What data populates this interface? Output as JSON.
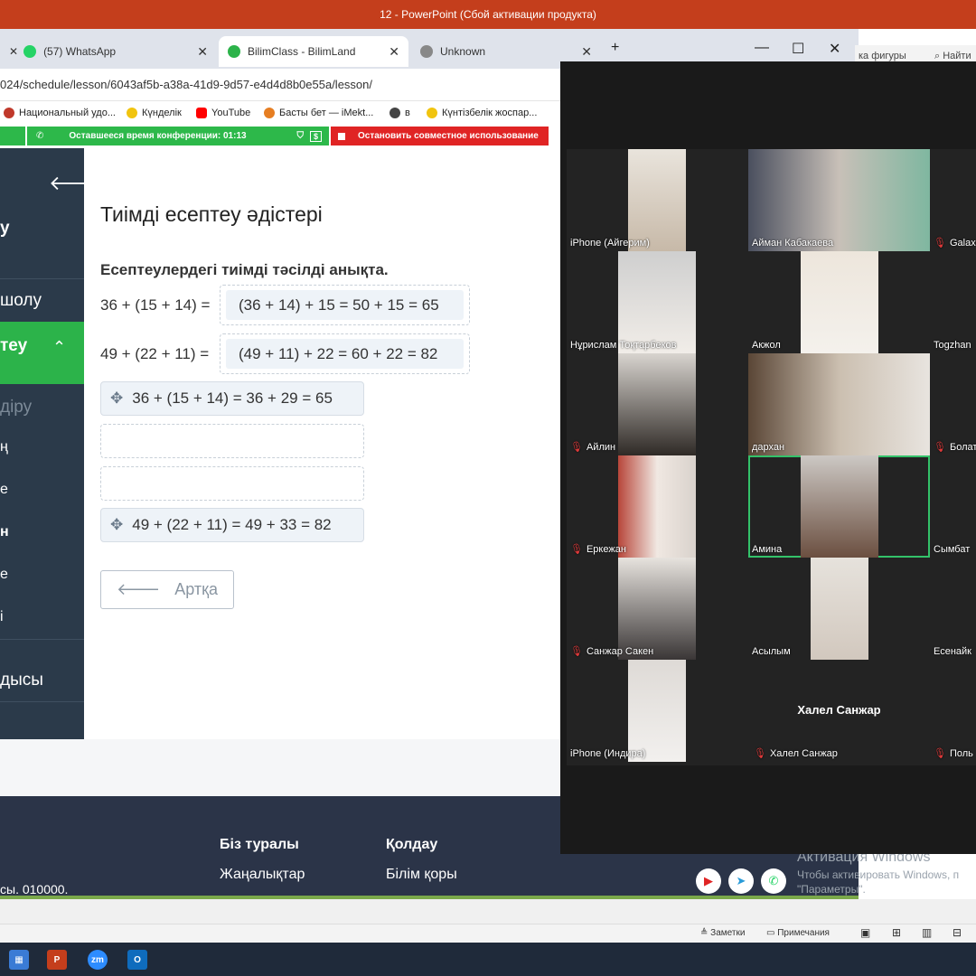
{
  "ppt": {
    "title": "12 - PowerPoint (Сбой активации продукта)",
    "ribbon_fragment": "ка фигуры",
    "ribbon_find": "Найти",
    "status": {
      "notes": "Заметки",
      "comments": "Примечания"
    }
  },
  "browser": {
    "tabs": [
      {
        "label": "(57) WhatsApp",
        "icon": "whatsapp-icon",
        "color": "#25d366"
      },
      {
        "label": "BilimClass - BilimLand",
        "icon": "bilimclass-icon",
        "color": "#2cb34a"
      },
      {
        "label": "Unknown",
        "icon": "globe-icon",
        "color": "#888888"
      }
    ],
    "new_tab": "+",
    "url": "024/schedule/lesson/6043af5b-a38a-41d9-9d57-e4d4d8b0e55a/lesson/",
    "bookmarks": [
      {
        "label": "Национальный удо...",
        "color": "#c0392b"
      },
      {
        "label": "Күнделік",
        "color": "#f1c40f"
      },
      {
        "label": "YouTube",
        "color": "#ff0000"
      },
      {
        "label": "Басты бет — iMekt...",
        "color": "#e67e22"
      },
      {
        "label": "в",
        "color": "#444444"
      },
      {
        "label": "Күнтізбелік жоспар...",
        "color": "#f1c40f"
      }
    ]
  },
  "share": {
    "time_label": "Оставшееся время конференции: 01:13",
    "stop_label": "Остановить совместное использование"
  },
  "sidebar": {
    "items": [
      {
        "label": "у"
      },
      {
        "label": "шолу"
      },
      {
        "label": "теу"
      },
      {
        "label": "діру"
      },
      {
        "label": "ң"
      },
      {
        "label": "е"
      },
      {
        "label": "н"
      },
      {
        "label": "е"
      },
      {
        "label": "і"
      },
      {
        "label": "дысы"
      }
    ]
  },
  "lesson": {
    "title": "Тиімді есептеу әдістері",
    "task": "Есептеулердегі тиімді тәсілді анықта.",
    "rows": [
      {
        "left": "36 + (15 + 14) =",
        "answer": "(36 + 14) + 15 = 50 + 15 = 65"
      },
      {
        "left": "49 + (22 + 11) =",
        "answer": "(49 + 11) + 22 = 60 + 22 = 82"
      }
    ],
    "cards": [
      "36 + (15 + 14) = 36 + 29 = 65",
      "",
      "",
      "49 + (22 + 11) = 49 + 33 = 82"
    ],
    "back_label": "Артқа"
  },
  "footer": {
    "about": "Біз туралы",
    "support": "Қолдау",
    "news": "Жаңалықтар",
    "knowledge": "Білім қоры",
    "address": "сы. 010000."
  },
  "activation": {
    "title": "Активация Windows",
    "line1": "Чтобы активировать Windows, п",
    "line2": "\"Параметры\"."
  },
  "zoom": {
    "participants": [
      {
        "name": "iPhone (Айгерим)",
        "muted": false
      },
      {
        "name": "Айман Кабакаева",
        "muted": false
      },
      {
        "name": "Galax",
        "muted": true
      },
      {
        "name": "Нұрислам Тоқтарбеков",
        "muted": false
      },
      {
        "name": "Акжол",
        "muted": false
      },
      {
        "name": "Togzhan",
        "muted": false
      },
      {
        "name": "Айлин",
        "muted": true
      },
      {
        "name": "дархан",
        "muted": false
      },
      {
        "name": "Болат",
        "muted": true
      },
      {
        "name": "Еркежан",
        "muted": true
      },
      {
        "name": "Амина",
        "muted": false
      },
      {
        "name": "Сымбат",
        "muted": false
      },
      {
        "name": "Санжар Сакен",
        "muted": true
      },
      {
        "name": "Асылым",
        "muted": false
      },
      {
        "name": "Есенайк",
        "muted": false
      },
      {
        "name": "iPhone (Индира)",
        "muted": false
      },
      {
        "name": "Халел Санжар",
        "muted": true
      },
      {
        "name": "Поль",
        "muted": true
      }
    ],
    "center_name": "Халел Санжар"
  }
}
